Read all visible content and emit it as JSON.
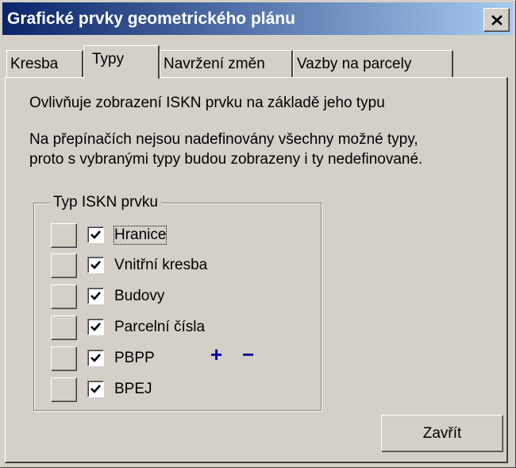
{
  "window": {
    "title": "Grafické prvky geometrického plánu",
    "close_glyph": "✕"
  },
  "tabs": [
    {
      "label": "Kresba",
      "active": false
    },
    {
      "label": "Typy",
      "active": true
    },
    {
      "label": "Navržení změn",
      "active": false
    },
    {
      "label": "Vazby na parcely",
      "active": false
    }
  ],
  "panel": {
    "line1": "Ovlivňuje zobrazení ISKN prvku na základě jeho typu",
    "line2": "Na přepínačích nejsou nadefinovány všechny možné typy,",
    "line3": "proto s vybranými typy budou zobrazeny i ty nedefinované."
  },
  "group": {
    "label": "Typ ISKN prvku",
    "items": [
      {
        "label": "Hranice",
        "checked": true
      },
      {
        "label": "Vnitřní kresba",
        "checked": true
      },
      {
        "label": "Budovy",
        "checked": true
      },
      {
        "label": "Parcelní čísla",
        "checked": true
      },
      {
        "label": "PBPP",
        "checked": true
      },
      {
        "label": "BPEJ",
        "checked": true
      }
    ]
  },
  "zoom": {
    "plus": "+",
    "minus": "−"
  },
  "buttons": {
    "close": "Zavřít"
  },
  "colors": {
    "titlebar_start": "#0a246a",
    "titlebar_end": "#a6caf0",
    "face": "#d4d0c8",
    "zoom": "#0000a0"
  }
}
